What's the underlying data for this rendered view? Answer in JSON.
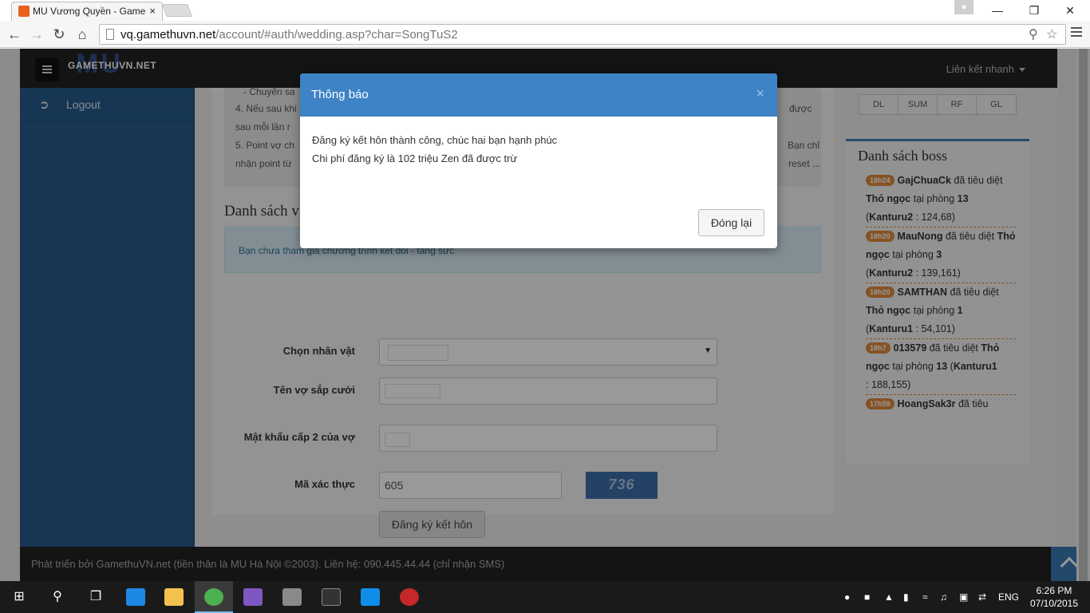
{
  "browser": {
    "tab_title": "MU Vương Quyền - Game",
    "tab_close": "×",
    "url_host": "vq.gamethuvn.net",
    "url_path": "/account/#auth/wedding.asp?char=SongTuS2"
  },
  "site": {
    "logo_text": "GAMETHUVN.NET",
    "logo_mu": "MU",
    "quick_link": "Liên kết nhanh",
    "sidebar": {
      "logout_label": "Logout"
    },
    "info_lines": [
      "- Chuyển sa",
      "4. Nếu sau khi",
      "sau mỗi lần r",
      "5. Point vợ ch",
      "nhận point từ"
    ],
    "info_lines_right": [
      "được",
      "Bạn chỉ",
      "reset ..."
    ],
    "section_title": "Danh sách v",
    "alert_text": "Bạn chưa tham gia chương trình kết đôi - tăng sức",
    "form": {
      "choose_char_label": "Chọn nhân vật",
      "spouse_name_label": "Tên vợ sắp cưới",
      "spouse_pw_label": "Mật khẩu cấp 2 của vợ",
      "captcha_label": "Mã xác thực",
      "captcha_value": "605",
      "captcha_image_text": "736",
      "submit_label": "Đăng ký kết hôn"
    },
    "stat_tabs": [
      "DL",
      "SUM",
      "RF",
      "GL"
    ],
    "boss_title": "Danh sách boss",
    "boss_list": [
      {
        "time": "18h24",
        "player": "GajChuaCk",
        "action": "đã tiêu diệt",
        "boss": "Thỏ ngọc",
        "room_text": "tại phòng",
        "room": "13",
        "server": "Kanturu2",
        "score": ": 124,68)"
      },
      {
        "time": "18h20",
        "player": "MauNong",
        "action": "đã tiêu diệt",
        "boss": "Thỏ ngọc",
        "room_text": "tại phòng",
        "room": "3",
        "server": "Kanturu2",
        "score": ": 139,161)"
      },
      {
        "time": "18h20",
        "player": "SAMTHAN",
        "action": "đã tiêu diệt",
        "boss": "Thỏ ngọc",
        "room_text": "tại phòng",
        "room": "1",
        "server": "Kanturu1",
        "score": ": 54,101)"
      },
      {
        "time": "18h7",
        "player": "013579",
        "action": "đã tiêu diệt",
        "boss": "Thỏ ngọc",
        "room_text": "tại phòng",
        "room": "13",
        "server": "Kanturu1",
        "score": ": 188,155)"
      },
      {
        "time": "17h59",
        "player": "HoangSak3r",
        "action": "đã tiêu",
        "boss": "",
        "room_text": "",
        "room": "",
        "server": "",
        "score": ""
      }
    ],
    "footer_text": "Phát triển bởi GamethuVN.net (tiền thân là MU Hà Nội ©2003). Liên hệ: 090.445.44.44 (chỉ nhận SMS)"
  },
  "modal": {
    "title": "Thông báo",
    "close": "×",
    "line1": "Đăng ký kết hôn thành công, chúc hai bạn hạnh phúc",
    "line2": "Chi phí đăng ký là 102 triệu Zen đã được trừ",
    "button": "Đóng lại"
  },
  "taskbar": {
    "lang": "ENG",
    "time": "6:26 PM",
    "date": "07/10/2015"
  },
  "colors": {
    "sidebar": "#265a8c",
    "modal_header": "#3d83c6",
    "badge": "#e08a3d"
  }
}
